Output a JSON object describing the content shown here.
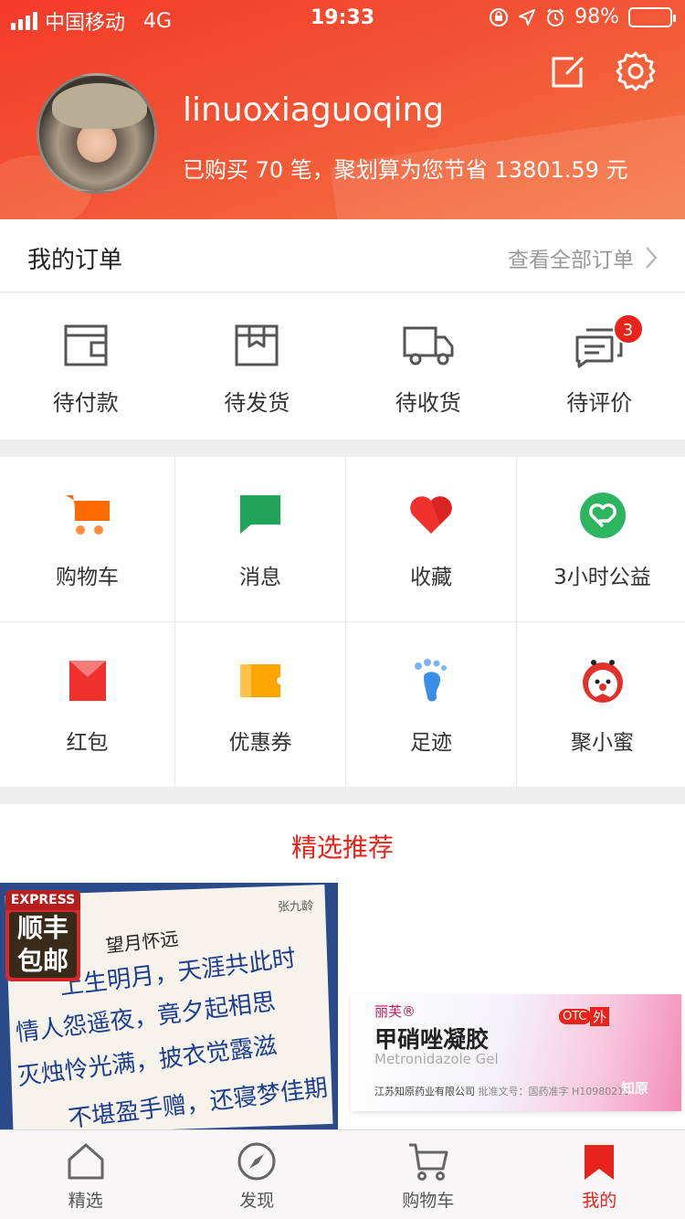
{
  "status_bar": {
    "carrier": "中国移动",
    "network": "4G",
    "time": "19:33",
    "battery": "98%",
    "battery_level": 0.98
  },
  "header": {
    "username": "linuoxiaguoqing",
    "summary": "已购买 70 笔，聚划算为您节省 13801.59 元",
    "icons": [
      "edit-icon",
      "settings-gear-icon"
    ]
  },
  "orders": {
    "title": "我的订单",
    "view_all": "查看全部订单",
    "items": [
      {
        "label": "待付款",
        "icon": "wallet-icon"
      },
      {
        "label": "待发货",
        "icon": "package-box-icon"
      },
      {
        "label": "待收货",
        "icon": "delivery-truck-icon"
      },
      {
        "label": "待评价",
        "icon": "comment-icon",
        "badge": "3"
      }
    ]
  },
  "grid": {
    "items": [
      {
        "label": "购物车",
        "icon": "shopping-cart-icon",
        "color": "#ff6a00"
      },
      {
        "label": "消息",
        "icon": "message-bubble-icon",
        "color": "#22a35a"
      },
      {
        "label": "收藏",
        "icon": "heart-icon",
        "color": "#f0312d"
      },
      {
        "label": "3小时公益",
        "icon": "charity-heart-icon",
        "color": "#2db45e"
      },
      {
        "label": "红包",
        "icon": "red-envelope-icon",
        "color": "#f0312d"
      },
      {
        "label": "优惠券",
        "icon": "coupon-ticket-icon",
        "color": "#ffa400"
      },
      {
        "label": "足迹",
        "icon": "footprint-icon",
        "color": "#3a8ee8"
      },
      {
        "label": "聚小蜜",
        "icon": "mascot-face-icon",
        "color": "#e0322b"
      }
    ]
  },
  "recommend": {
    "title": "精选推荐",
    "product1": {
      "express_label": "EXPRESS",
      "express_text": "顺丰包邮",
      "calligraphy_title": "望月怀远",
      "calligraphy_author": "张九龄",
      "lines": [
        "上生明月，天涯共此时",
        "情人怨遥夜，竟夕起相思",
        "灭烛怜光满，披衣觉露滋",
        "不堪盈手赠，还寝梦佳期"
      ]
    },
    "product2": {
      "brand": "丽芙®",
      "name": "甲硝唑凝胶",
      "name_en": "Metronidazole Gel",
      "manufacturer": "江苏知原药业有限公司",
      "approval": "批准文号：国药准字 H10980213",
      "otc": "OTC",
      "ext": "外",
      "logo": "知原"
    }
  },
  "tabbar": {
    "items": [
      {
        "label": "精选",
        "icon": "home-icon",
        "active": false
      },
      {
        "label": "发现",
        "icon": "compass-icon",
        "active": false
      },
      {
        "label": "购物车",
        "icon": "cart-tab-icon",
        "active": false
      },
      {
        "label": "我的",
        "icon": "bookmark-icon",
        "active": true
      }
    ],
    "active_color": "#e8231a"
  }
}
